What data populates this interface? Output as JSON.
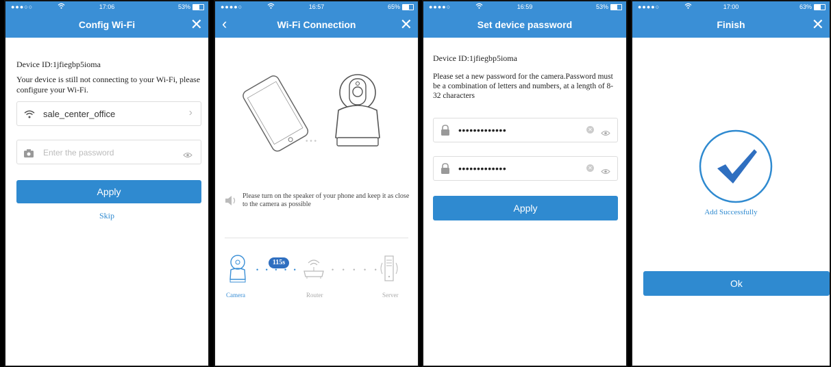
{
  "screens": [
    {
      "status": {
        "signal": "●●●○○",
        "time": "17:06",
        "battery": "53%"
      },
      "title": "Config Wi-Fi",
      "device_id": "Device ID:1jfiegbp5ioma",
      "message": "Your device is still not connecting to your Wi-Fi, please configure your Wi-Fi.",
      "ssid": "sale_center_office",
      "password_placeholder": "Enter the password",
      "apply_label": "Apply",
      "skip_label": "Skip"
    },
    {
      "status": {
        "signal": "●●●●○",
        "time": "16:57",
        "battery": "65%"
      },
      "title": "Wi-Fi Connection",
      "speaker_hint": "Please turn on the speaker of your phone and keep it as close to the camera as possible",
      "countdown": "115s",
      "steps": [
        "Camera",
        "Router",
        "Server"
      ]
    },
    {
      "status": {
        "signal": "●●●●○",
        "time": "16:59",
        "battery": "53%"
      },
      "title": "Set device password",
      "device_id": "Device ID:1jfiegbp5ioma",
      "message": "Please set a new password for the camera.Password must be a combination of letters and numbers, at a length of 8-32 characters",
      "password1": "•••••••••••••",
      "password2": "•••••••••••••",
      "apply_label": "Apply"
    },
    {
      "status": {
        "signal": "●●●●○",
        "time": "17:00",
        "battery": "63%"
      },
      "title": "Finish",
      "success_text": "Add Successfully",
      "ok_label": "Ok"
    }
  ],
  "colors": {
    "accent": "#2f8ad0",
    "navbar": "#3a8fd6"
  }
}
